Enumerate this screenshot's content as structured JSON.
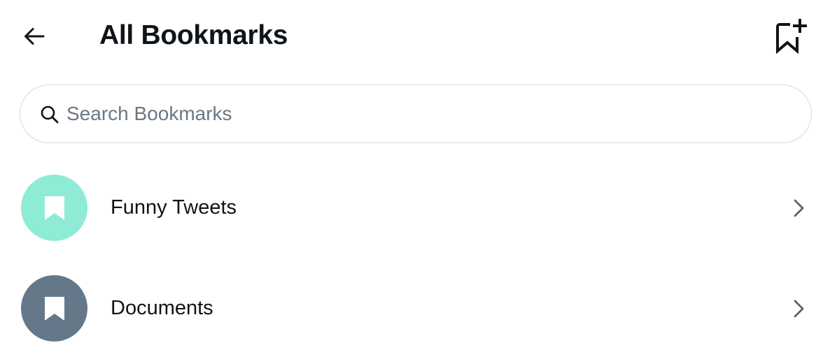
{
  "header": {
    "title": "All Bookmarks",
    "back_icon": "arrow-left-icon",
    "new_folder_icon": "bookmark-plus-icon"
  },
  "search": {
    "placeholder": "Search Bookmarks",
    "value": "",
    "icon": "search-icon"
  },
  "folders": [
    {
      "label": "Funny Tweets",
      "color": "#8eecd6",
      "icon": "bookmark-icon"
    },
    {
      "label": "Documents",
      "color": "#64788a",
      "icon": "bookmark-icon"
    }
  ],
  "colors": {
    "text_primary": "#0f1419",
    "text_secondary": "#6b7782",
    "border": "#cfd9de",
    "chevron": "#536471"
  }
}
